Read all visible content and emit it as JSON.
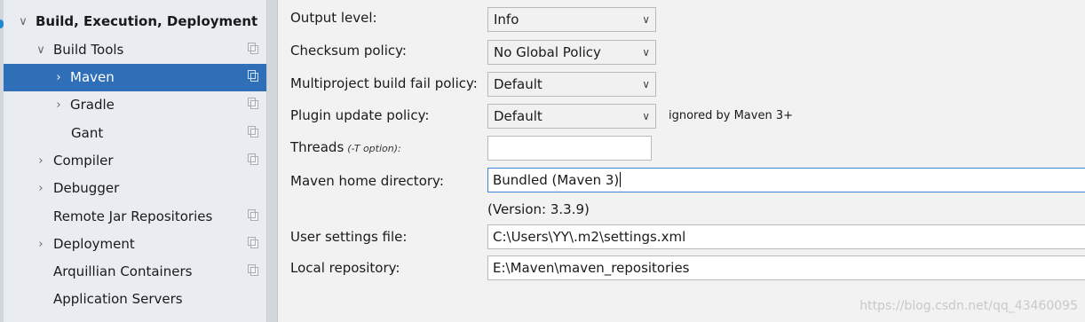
{
  "tree": {
    "section": "Build, Execution, Deployment",
    "items": [
      {
        "label": "Build Tools"
      },
      {
        "label": "Maven"
      },
      {
        "label": "Gradle"
      },
      {
        "label": "Gant"
      },
      {
        "label": "Compiler"
      },
      {
        "label": "Debugger"
      },
      {
        "label": "Remote Jar Repositories"
      },
      {
        "label": "Deployment"
      },
      {
        "label": "Arquillian Containers"
      },
      {
        "label": "Application Servers"
      }
    ]
  },
  "form": {
    "output_level": {
      "label": "Output level:",
      "value": "Info"
    },
    "checksum_policy": {
      "label": "Checksum policy:",
      "value": "No Global Policy"
    },
    "multiproject_fail_policy": {
      "label": "Multiproject build fail policy:",
      "value": "Default"
    },
    "plugin_update_policy": {
      "label": "Plugin update policy:",
      "value": "Default",
      "note": "ignored by Maven 3+"
    },
    "threads": {
      "label": "Threads",
      "hint": "(-T option):",
      "value": ""
    },
    "maven_home": {
      "label": "Maven home directory:",
      "value": "Bundled (Maven 3)"
    },
    "version": "(Version: 3.3.9)",
    "user_settings": {
      "label": "User settings file:",
      "value": "C:\\Users\\YY\\.m2\\settings.xml"
    },
    "local_repository": {
      "label": "Local repository:",
      "value": "E:\\Maven\\maven_repositories"
    }
  },
  "watermark": "https://blog.csdn.net/qq_43460095",
  "colors": {
    "selection": "#2f6fb8",
    "focus_border": "#3d84d6"
  }
}
